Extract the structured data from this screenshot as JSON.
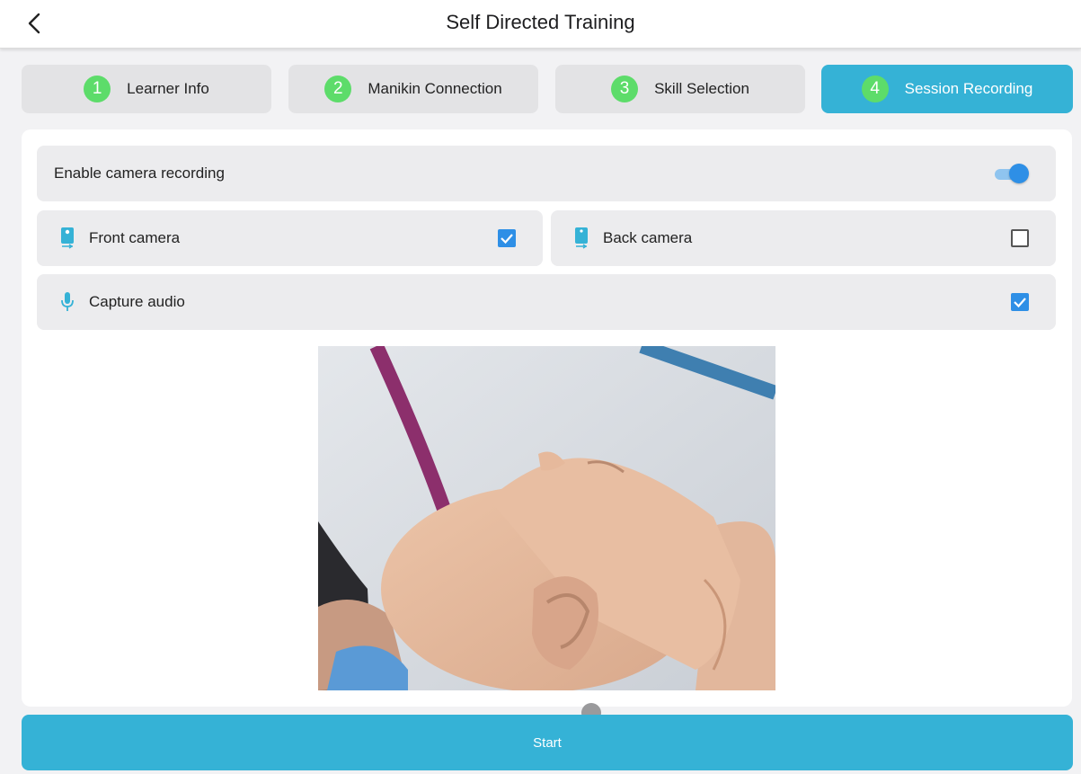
{
  "header": {
    "title": "Self Directed Training",
    "back_icon": "chevron-left-icon"
  },
  "steps": [
    {
      "number": "1",
      "label": "Learner Info",
      "active": false
    },
    {
      "number": "2",
      "label": "Manikin Connection",
      "active": false
    },
    {
      "number": "3",
      "label": "Skill Selection",
      "active": false
    },
    {
      "number": "4",
      "label": "Session Recording",
      "active": true
    }
  ],
  "recording": {
    "enable_label": "Enable camera recording",
    "enable_on": true,
    "front_camera_label": "Front camera",
    "front_camera_checked": true,
    "back_camera_label": "Back camera",
    "back_camera_checked": false,
    "capture_audio_label": "Capture audio",
    "capture_audio_checked": true
  },
  "icons": {
    "front_camera": "front-camera-icon",
    "back_camera": "back-camera-icon",
    "microphone": "microphone-icon"
  },
  "start_button": "Start",
  "colors": {
    "accent": "#35b2d6",
    "step_number": "#5ddc6a",
    "checkbox": "#2e8fe6"
  }
}
